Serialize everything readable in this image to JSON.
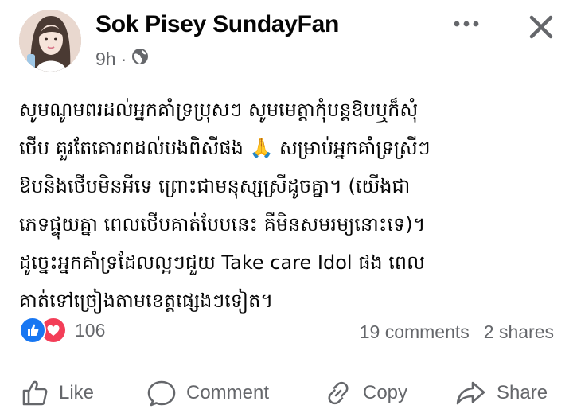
{
  "post": {
    "author": "Sok Pisey SundayFan",
    "timestamp": "9h",
    "audience_icon": "globe-icon",
    "text_lines": [
      "សូមណូមពរដល់អ្នកគាំទ្រប្រុសៗ សូមមេត្តាកុំបន្តឱបឬក៏សុំ",
      "ថើប គួរតែគោរពដល់បងពិសីផង 🙏 សម្រាប់អ្នកគាំទ្រស្រីៗ",
      "ឱបនិងថើបមិនអីទេ ព្រោះជាមនុស្សស្រីដូចគ្នា។ (យើងជា",
      "ភេទផ្ទុយគ្នា ពេលថើបគាត់បែបនេះ គឺមិនសមរម្យនោះទេ)។",
      "ដូច្នេះអ្នកគាំទ្រដែលល្អៗជួយ Take care Idol ផង ពេល",
      "គាត់ទៅច្រៀងតាមខេត្តផ្សេងៗទៀត។"
    ]
  },
  "stats": {
    "reaction_count": "106",
    "comments": "19 comments",
    "shares": "2 shares"
  },
  "actions": {
    "like": "Like",
    "comment": "Comment",
    "copy": "Copy",
    "share": "Share"
  },
  "colors": {
    "like_blue": "#1877f2",
    "love_red": "#f33e58",
    "secondary_text": "#65676b"
  }
}
